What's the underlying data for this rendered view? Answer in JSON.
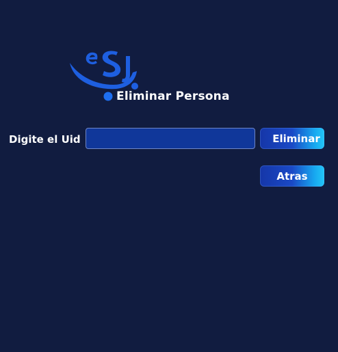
{
  "header": {
    "title": "Eliminar Persona",
    "logo_text": "eS",
    "logo_icon": "esj-logo-icon"
  },
  "form": {
    "uid_label": "Digite el Uid",
    "uid_value": "",
    "uid_placeholder": ""
  },
  "buttons": {
    "delete_label": "Eliminar",
    "back_label": "Atras"
  },
  "colors": {
    "background": "#111c40",
    "input_bg": "#10379a",
    "button_start": "#1536a8",
    "button_end": "#22c6f7",
    "logo_blue": "#1e5fe0"
  }
}
